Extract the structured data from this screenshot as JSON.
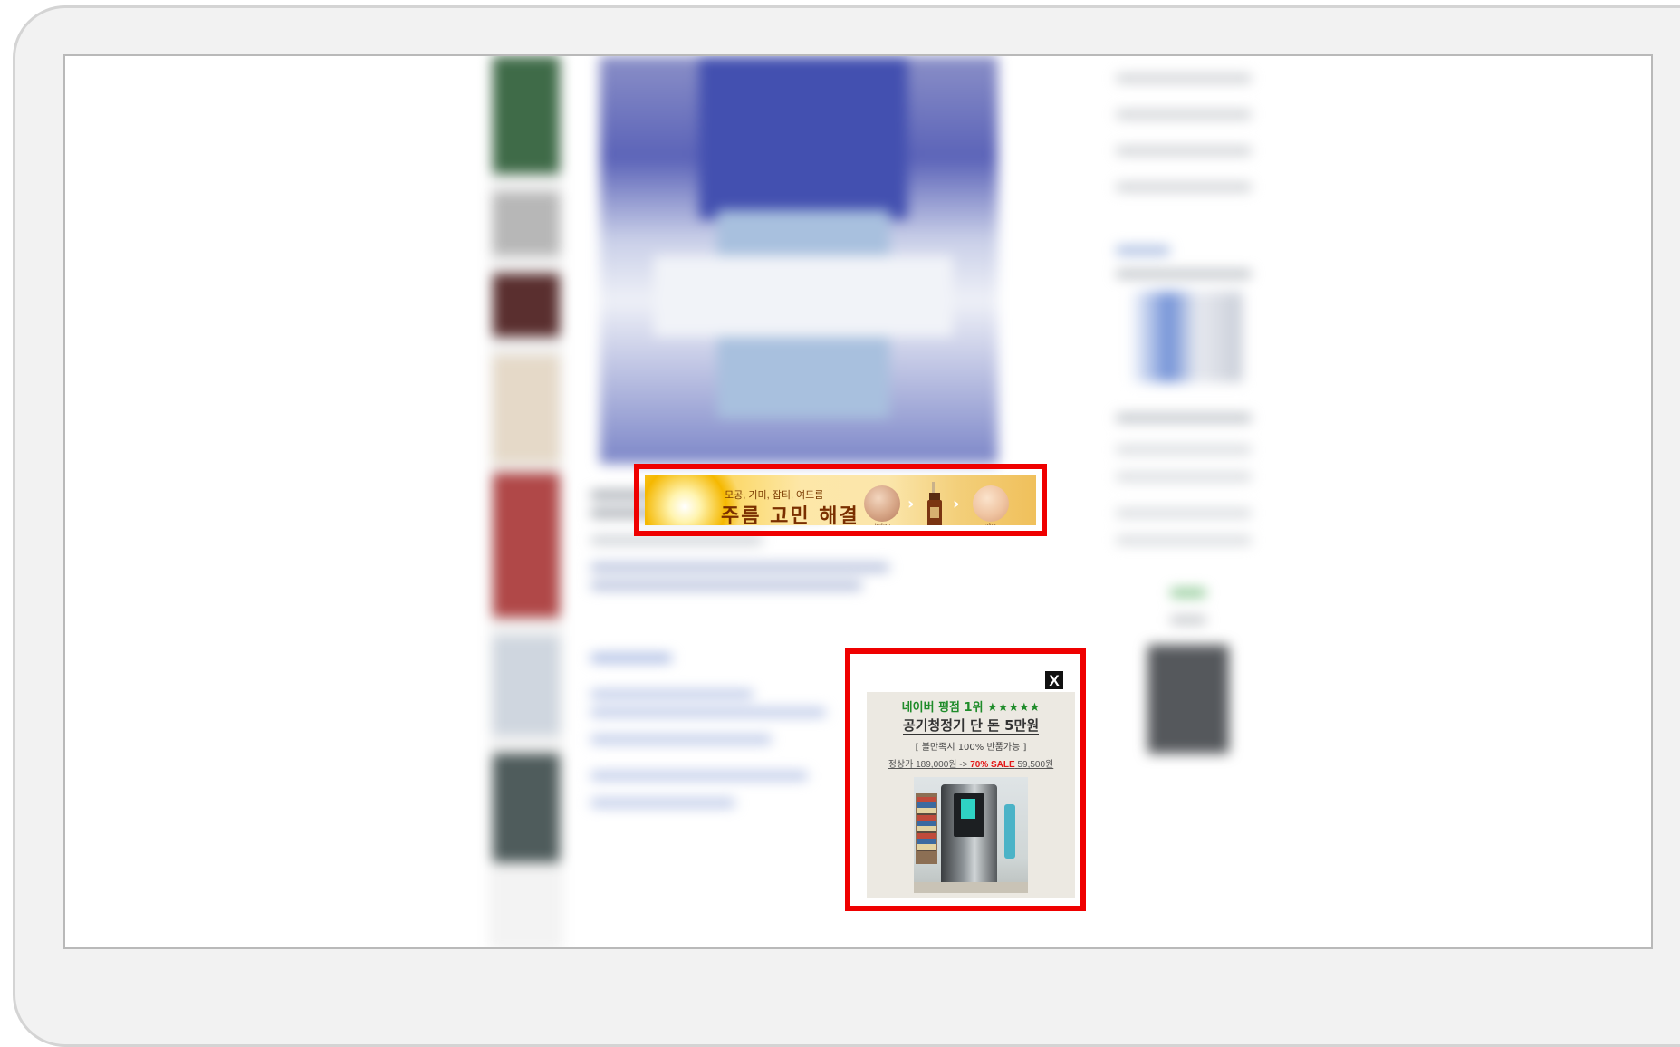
{
  "top_banner_ad": {
    "subline": "모공, 기미, 잡티, 여드름",
    "headline": "주름 고민 해결",
    "before_label": "before",
    "after_label": "after",
    "outline_color": "#ef0000"
  },
  "popup_ad": {
    "close_label": "X",
    "rank_text": "네이버 평점 1위 ★★★★★",
    "main_text": "공기청정기 단 돈 5만원",
    "note": "[ 불만족시 100% 반품가능 ]",
    "price_regular": "정상가 189,000원 ->",
    "price_sale_label": "70% SALE",
    "price_sale_value": "59,500원",
    "outline_color": "#ef0000"
  }
}
